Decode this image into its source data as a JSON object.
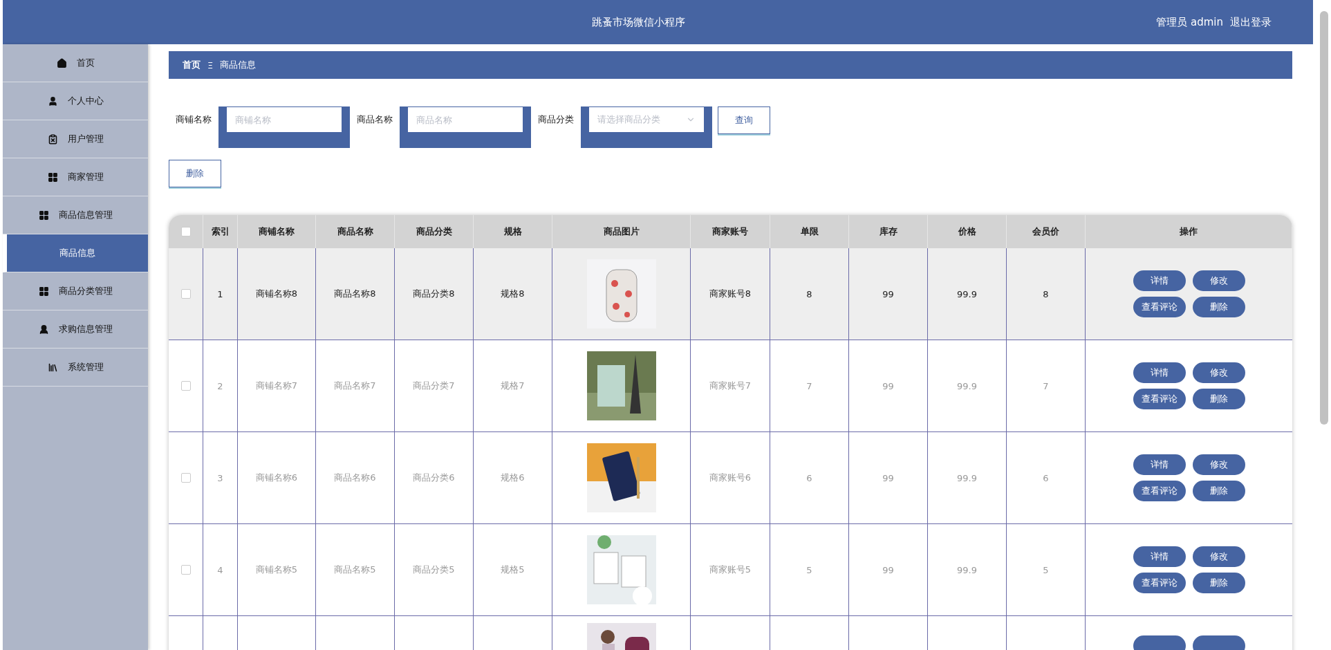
{
  "header": {
    "title": "跳蚤市场微信小程序",
    "user": "管理员 admin",
    "logout": "退出登录"
  },
  "sidebar": {
    "items": [
      {
        "label": "首页",
        "selected": false
      },
      {
        "label": "个人中心",
        "selected": false
      },
      {
        "label": "用户管理",
        "selected": false
      },
      {
        "label": "商家管理",
        "selected": false
      },
      {
        "label": "商品信息管理",
        "selected": false
      },
      {
        "label": "商品信息",
        "selected": true
      },
      {
        "label": "商品分类管理",
        "selected": false
      },
      {
        "label": "求购信息管理",
        "selected": false
      },
      {
        "label": "系统管理",
        "selected": false
      }
    ]
  },
  "breadcrumb": {
    "home": "首页",
    "separator": "Ξ",
    "current": "商品信息"
  },
  "filters": [
    {
      "label": "商铺名称",
      "kind": "input",
      "placeholder": "商铺名称"
    },
    {
      "label": "商品名称",
      "kind": "input",
      "placeholder": "商品名称"
    },
    {
      "label": "商品分类",
      "kind": "select",
      "placeholder": "请选择商品分类"
    }
  ],
  "search_button": "查询",
  "delete_button": "删除",
  "table": {
    "header_checked": false,
    "columns": [
      "索引",
      "商铺名称",
      "商品名称",
      "商品分类",
      "规格",
      "商品图片",
      "商家账号",
      "单限",
      "库存",
      "价格",
      "会员价",
      "操作"
    ],
    "rows": [
      {
        "checked": false,
        "highlighted": true,
        "cells": [
          "1",
          "商铺名称8",
          "商品名称8",
          "商品分类8",
          "规格8"
        ],
        "cells2": [
          "商家账号8",
          "8",
          "99",
          "99.9",
          "8"
        ],
        "actions": [
          "详情",
          "修改",
          "查看评论",
          "删除"
        ]
      },
      {
        "checked": false,
        "highlighted": false,
        "cells": [
          "2",
          "商铺名称7",
          "商品名称7",
          "商品分类7",
          "规格7"
        ],
        "cells2": [
          "商家账号7",
          "7",
          "99",
          "99.9",
          "7"
        ],
        "actions": [
          "详情",
          "修改",
          "查看评论",
          "删除"
        ]
      },
      {
        "checked": false,
        "highlighted": false,
        "cells": [
          "3",
          "商铺名称6",
          "商品名称6",
          "商品分类6",
          "规格6"
        ],
        "cells2": [
          "商家账号6",
          "6",
          "99",
          "99.9",
          "6"
        ],
        "actions": [
          "详情",
          "修改",
          "查看评论",
          "删除"
        ]
      },
      {
        "checked": false,
        "highlighted": false,
        "cells": [
          "4",
          "商铺名称5",
          "商品名称5",
          "商品分类5",
          "规格5"
        ],
        "cells2": [
          "商家账号5",
          "5",
          "99",
          "99.9",
          "5"
        ],
        "actions": [
          "详情",
          "修改",
          "查看评论",
          "删除"
        ]
      },
      {
        "highlighted": false
      }
    ]
  }
}
